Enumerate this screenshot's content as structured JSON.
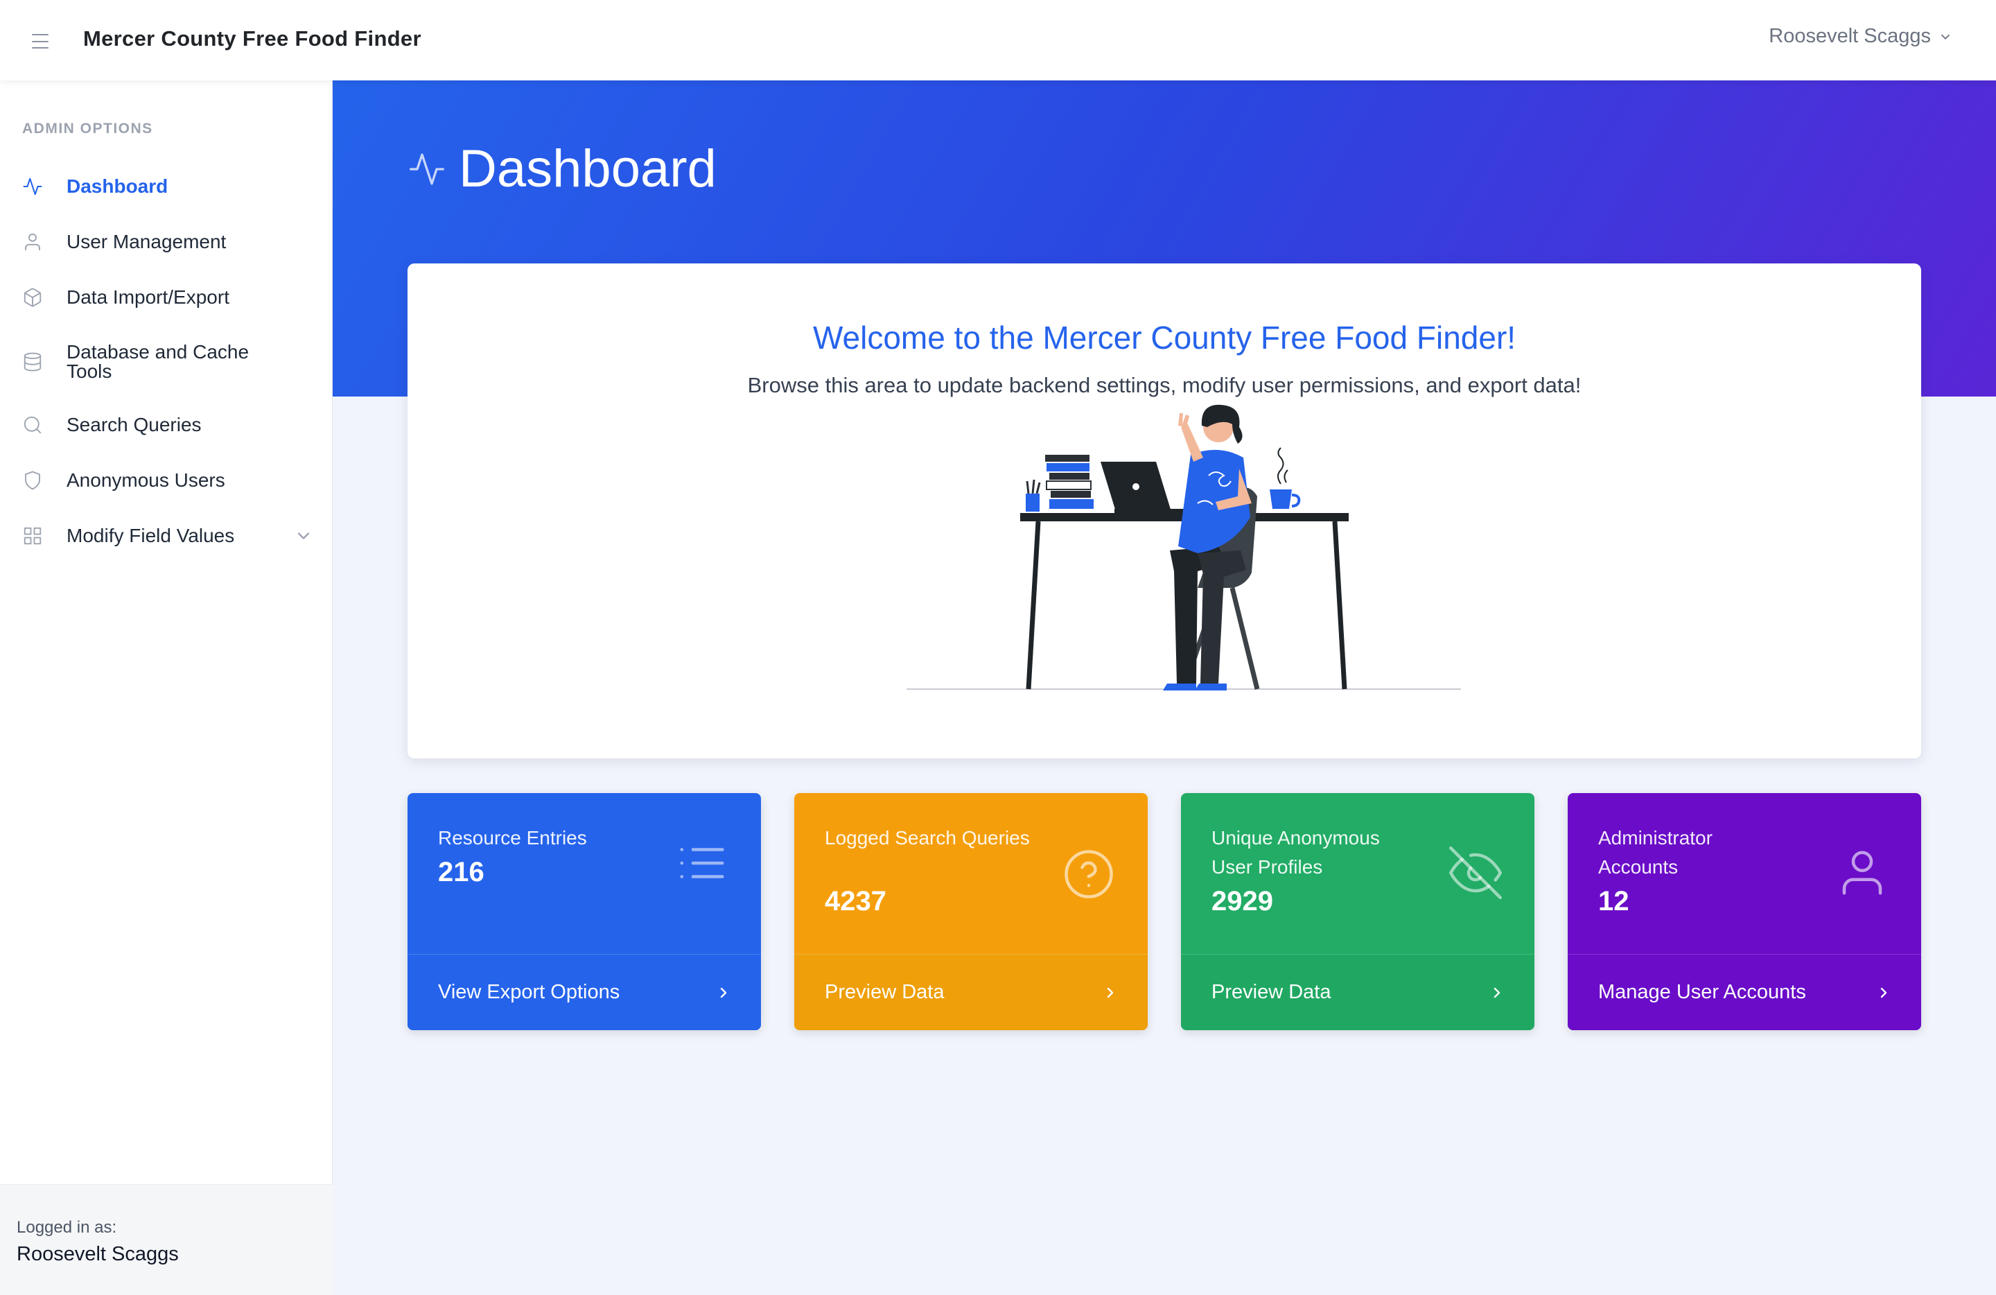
{
  "app": {
    "title": "Mercer County Free Food Finder",
    "user_name": "Roosevelt Scaggs"
  },
  "sidebar": {
    "heading": "ADMIN OPTIONS",
    "items": [
      {
        "label": "Dashboard",
        "icon": "activity-icon",
        "active": true
      },
      {
        "label": "User Management",
        "icon": "user-icon"
      },
      {
        "label": "Data Import/Export",
        "icon": "box-icon"
      },
      {
        "label": "Database and Cache Tools",
        "icon": "database-icon"
      },
      {
        "label": "Search Queries",
        "icon": "search-icon"
      },
      {
        "label": "Anonymous Users",
        "icon": "shield-icon"
      },
      {
        "label": "Modify Field Values",
        "icon": "grid-icon",
        "expandable": true
      }
    ],
    "footer": {
      "logged_in_label": "Logged in as:",
      "user_name": "Roosevelt Scaggs"
    }
  },
  "page": {
    "title": "Dashboard"
  },
  "welcome": {
    "title": "Welcome to the Mercer County Free Food Finder!",
    "subtitle": "Browse this area to update backend settings, modify user permissions, and export data!"
  },
  "stats": [
    {
      "label": "Resource Entries",
      "value": "216",
      "action": "View Export Options",
      "icon": "list-icon",
      "color": "#2563eb",
      "footer_color": "#2563eb"
    },
    {
      "label": "Logged Search Queries",
      "value": "4237",
      "action": "Preview Data",
      "icon": "help-circle-icon",
      "color": "#f59e0b",
      "footer_color": "#ee9f0a"
    },
    {
      "label": "Unique Anonymous User Profiles",
      "value": "2929",
      "action": "Preview Data",
      "icon": "eye-off-icon",
      "color": "#22ac66",
      "footer_color": "#20a862"
    },
    {
      "label": "Administrator Accounts",
      "value": "12",
      "action": "Manage User Accounts",
      "icon": "user-icon",
      "color": "#6a0cc8",
      "footer_color": "#6a0cc8"
    }
  ],
  "colors": {
    "accent": "#2563eb",
    "hero_start": "#2563eb",
    "hero_end": "#5a25d6"
  }
}
